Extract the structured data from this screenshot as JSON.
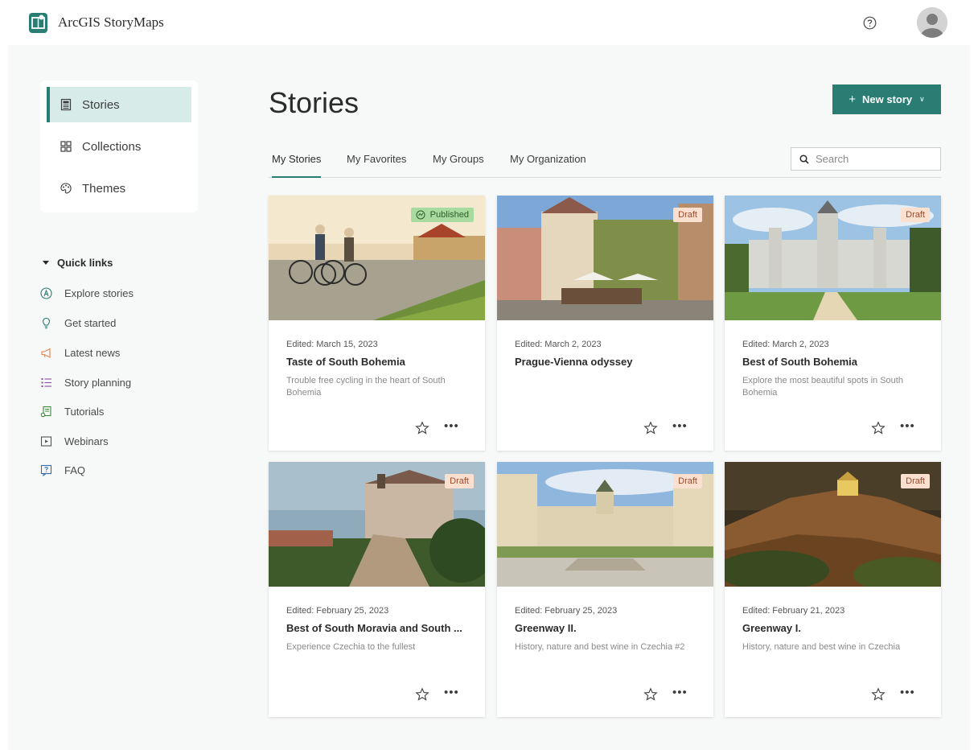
{
  "app": {
    "title": "ArcGIS StoryMaps"
  },
  "sidenav": {
    "items": [
      {
        "label": "Stories",
        "icon": "stories-icon",
        "active": true
      },
      {
        "label": "Collections",
        "icon": "collections-icon",
        "active": false
      },
      {
        "label": "Themes",
        "icon": "themes-icon",
        "active": false
      }
    ]
  },
  "quick_links": {
    "title": "Quick links",
    "items": [
      {
        "label": "Explore stories",
        "icon": "explore-icon"
      },
      {
        "label": "Get started",
        "icon": "lightbulb-icon"
      },
      {
        "label": "Latest news",
        "icon": "megaphone-icon"
      },
      {
        "label": "Story planning",
        "icon": "list-icon"
      },
      {
        "label": "Tutorials",
        "icon": "tutorial-icon"
      },
      {
        "label": "Webinars",
        "icon": "video-icon"
      },
      {
        "label": "FAQ",
        "icon": "faq-icon"
      }
    ]
  },
  "header": {
    "title": "Stories",
    "new_story_label": "New story"
  },
  "tabs": [
    "My Stories",
    "My Favorites",
    "My Groups",
    "My Organization"
  ],
  "search": {
    "placeholder": "Search"
  },
  "colors": {
    "accent": "#297d73",
    "active_nav_bg": "#d7ece8",
    "draft_badge": "#fbe0d0",
    "published_badge": "#a9dba0"
  },
  "cards": [
    {
      "status": "Published",
      "edited": "Edited: March 15, 2023",
      "title": "Taste of South Bohemia",
      "description": "Trouble free cycling in the heart of South Bohemia"
    },
    {
      "status": "Draft",
      "edited": "Edited: March 2, 2023",
      "title": "Prague-Vienna odyssey",
      "description": ""
    },
    {
      "status": "Draft",
      "edited": "Edited: March 2, 2023",
      "title": "Best of South Bohemia",
      "description": "Explore the most beautiful spots in South Bohemia"
    },
    {
      "status": "Draft",
      "edited": "Edited: February 25, 2023",
      "title": "Best of South Moravia and South ...",
      "description": "Experience Czechia to the fullest"
    },
    {
      "status": "Draft",
      "edited": "Edited: February 25, 2023",
      "title": "Greenway II.",
      "description": "History, nature and best wine in Czechia #2"
    },
    {
      "status": "Draft",
      "edited": "Edited: February 21, 2023",
      "title": "Greenway I.",
      "description": "History, nature and best wine in Czechia"
    }
  ]
}
